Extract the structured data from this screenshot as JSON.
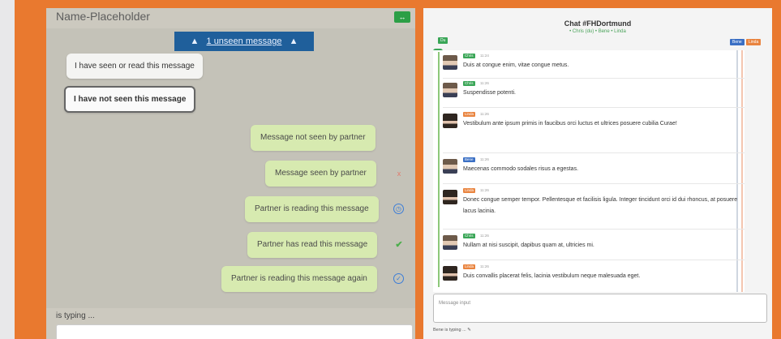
{
  "left": {
    "title": "Name-Placeholder",
    "expand_label": "↔",
    "unseen": {
      "arrow_left": "▲",
      "text": "1 unseen message",
      "arrow_right": "▲"
    },
    "incoming": [
      {
        "text": "I have seen or read this message"
      },
      {
        "text": "I have not seen this message"
      }
    ],
    "outgoing": [
      {
        "text": "Message not seen by partner",
        "status": ""
      },
      {
        "text": "Message seen by partner",
        "status": "x"
      },
      {
        "text": "Partner is reading this message",
        "status": "◷"
      },
      {
        "text": "Partner has read this message",
        "status": "✔"
      },
      {
        "text": "Partner is reading this message again",
        "status": "✓"
      }
    ],
    "typing": "is typing ...",
    "input_value": ""
  },
  "right": {
    "title": "Chat #FHDortmund",
    "subtitle": "• Chris (du) • Bene • Linda",
    "tags": {
      "left": "Du",
      "b1": "Bene",
      "b2": "Linda",
      "badge": "1"
    },
    "messages": [
      {
        "author": "Chris",
        "time": "11:24",
        "avatar": "male",
        "color": "green",
        "text": "Duis at congue enim, vitae congue metus."
      },
      {
        "author": "Chris",
        "time": "11:26",
        "avatar": "male",
        "color": "green",
        "text": "Suspendisse potenti."
      },
      {
        "author": "Linda",
        "time": "11:26",
        "avatar": "female",
        "color": "orange",
        "text": "Vestibulum ante ipsum primis in faucibus orci luctus et ultrices posuere cubilia Curae!"
      },
      {
        "author": "Bene",
        "time": "11:26",
        "avatar": "male",
        "color": "blue",
        "text": "Maecenas commodo sodales risus a egestas."
      },
      {
        "author": "Linda",
        "time": "11:26",
        "avatar": "female",
        "color": "orange",
        "text": "Donec congue semper tempor. Pellentesque et facilisis ligula. Integer tincidunt orci id dui rhoncus, at posuere lacus lacinia."
      },
      {
        "author": "Chris",
        "time": "11:26",
        "avatar": "male",
        "color": "green",
        "text": "Nullam at nisi suscipit, dapibus quam at, ultricies mi."
      },
      {
        "author": "Linda",
        "time": "11:26",
        "avatar": "female",
        "color": "orange",
        "text": "Duis convallis placerat felis, lacinia vestibulum neque malesuada eget."
      }
    ],
    "input_placeholder": "Message input",
    "typing": "Bene is typing ... ✎"
  },
  "colors": {
    "accent": "#e9792f",
    "green": "#3aa657",
    "blue": "#1f5f9b",
    "orange": "#e9843f"
  }
}
